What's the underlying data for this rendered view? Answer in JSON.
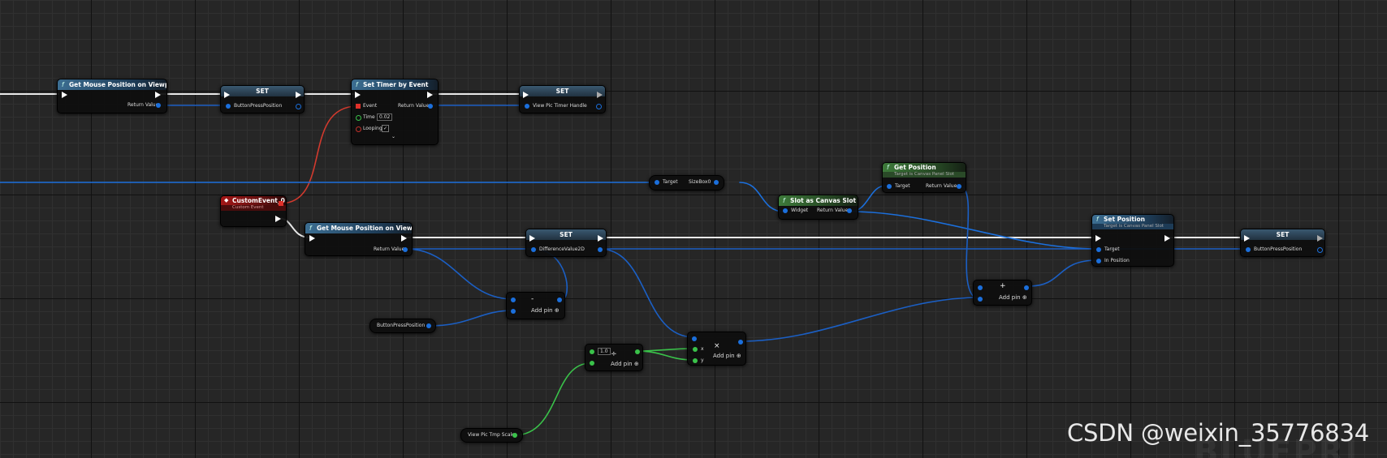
{
  "nodes": {
    "get_mouse_1": {
      "title": "Get Mouse Position on Viewport",
      "return_label": "Return Value"
    },
    "set_bp": {
      "title": "SET",
      "var_label": "ButtonPressPosition"
    },
    "set_timer": {
      "title": "Set Timer by Event",
      "event_label": "Event",
      "return_label": "Return Value",
      "time_label": "Time",
      "time_value": "0.02",
      "looping_label": "Looping",
      "looping_check": "✓",
      "expand": "⌄"
    },
    "set_handle": {
      "title": "SET",
      "var_label": "View Pic Timer Handle"
    },
    "custom_event": {
      "title": "CustomEvent_0",
      "subtitle": "Custom Event"
    },
    "get_mouse_2": {
      "title": "Get Mouse Position on Viewport",
      "return_label": "Return Value"
    },
    "set_diff": {
      "title": "SET",
      "var_label": "DifferenceValue2D"
    },
    "sizebox": {
      "target_label": "Target",
      "var_label": "SizeBox0"
    },
    "slot_cast": {
      "title": "Slot as Canvas Slot",
      "widget_label": "Widget",
      "return_label": "Return Value"
    },
    "get_position": {
      "title": "Get Position",
      "subtitle": "Target is Canvas Panel Slot",
      "target_label": "Target",
      "return_label": "Return Value"
    },
    "set_position": {
      "title": "Set Position",
      "subtitle": "Target is Canvas Panel Slot",
      "target_label": "Target",
      "inpos_label": "In Position"
    },
    "set_bp2": {
      "title": "SET",
      "var_label": "ButtonPressPosition"
    },
    "subtract": {
      "op": "-",
      "add_label": "Add pin ⊕"
    },
    "bp_getter": {
      "var_label": "ButtonPressPosition"
    },
    "add_node": {
      "op": "+",
      "add_label": "Add pin ⊕"
    },
    "divide": {
      "op": "÷",
      "value": "1.0",
      "add_label": "Add pin ⊕"
    },
    "multiply": {
      "op": "×",
      "x_label": "x",
      "y_label": "y",
      "add_label": "Add pin ⊕"
    },
    "scale_getter": {
      "var_label": "View Pic Tmp Scale"
    }
  },
  "watermark": "CSDN @weixin_35776834",
  "canvas_mark": "BLUEPRI",
  "colors": {
    "exec": "#ffffff",
    "vector2d": "#1b6fdc",
    "float": "#3ac24a",
    "event_delegate": "#e0302a"
  }
}
